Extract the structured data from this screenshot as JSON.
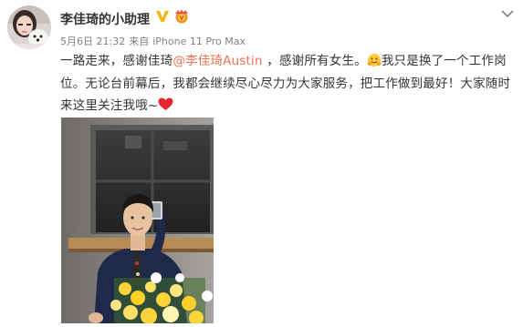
{
  "post": {
    "author": "李佳琦的小助理",
    "date": "5月6日 21:32",
    "source_prefix": "来自",
    "source_device": "iPhone 11 Pro Max",
    "text_part1": "一路走来，感谢佳琦",
    "mention": "@李佳琦Austin",
    "text_part2": " ，感谢所有女生。",
    "text_part3": "我只是换了一个工作岗位。无论台前幕后，我都会继续尽心尽力为大家服务，把工作做到最好！大家随时来这里关注我哦~",
    "icons": {
      "verified": "verified-v-icon",
      "member_badge": "member-badge-icon",
      "hug_emoji": "hug-emoji-icon",
      "heart_emoji": "red-heart-icon",
      "more": "chevron-down-icon"
    },
    "colors": {
      "mention": "#eb7350",
      "verified": "#f4b400",
      "heart": "#e8262f"
    }
  }
}
